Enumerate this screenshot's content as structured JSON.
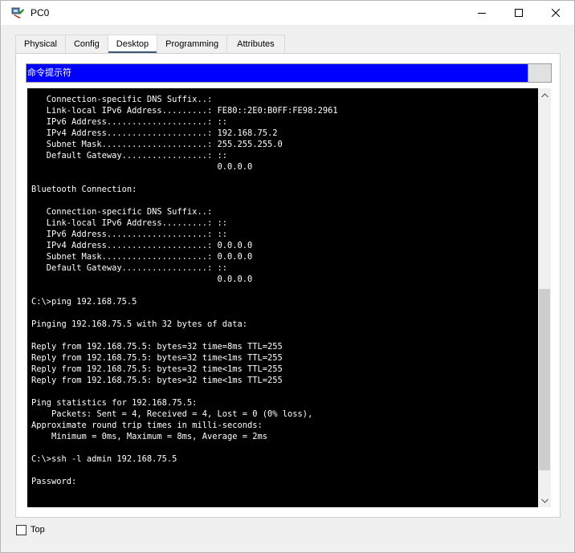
{
  "window": {
    "title": "PC0",
    "icon": "pc-device-icon"
  },
  "tabs": [
    {
      "label": "Physical",
      "active": false
    },
    {
      "label": "Config",
      "active": false
    },
    {
      "label": "Desktop",
      "active": true
    },
    {
      "label": "Programming",
      "active": false
    },
    {
      "label": "Attributes",
      "active": false
    }
  ],
  "cmd": {
    "title": "命令提示符",
    "lines": [
      "   Connection-specific DNS Suffix..:",
      "   Link-local IPv6 Address.........: FE80::2E0:B0FF:FE98:2961",
      "   IPv6 Address....................: ::",
      "   IPv4 Address....................: 192.168.75.2",
      "   Subnet Mask.....................: 255.255.255.0",
      "   Default Gateway.................: ::",
      "                                     0.0.0.0",
      "",
      "Bluetooth Connection:",
      "",
      "   Connection-specific DNS Suffix..:",
      "   Link-local IPv6 Address.........: ::",
      "   IPv6 Address....................: ::",
      "   IPv4 Address....................: 0.0.0.0",
      "   Subnet Mask.....................: 0.0.0.0",
      "   Default Gateway.................: ::",
      "                                     0.0.0.0",
      "",
      "C:\\>ping 192.168.75.5",
      "",
      "Pinging 192.168.75.5 with 32 bytes of data:",
      "",
      "Reply from 192.168.75.5: bytes=32 time=8ms TTL=255",
      "Reply from 192.168.75.5: bytes=32 time<1ms TTL=255",
      "Reply from 192.168.75.5: bytes=32 time<1ms TTL=255",
      "Reply from 192.168.75.5: bytes=32 time<1ms TTL=255",
      "",
      "Ping statistics for 192.168.75.5:",
      "    Packets: Sent = 4, Received = 4, Lost = 0 (0% loss),",
      "Approximate round trip times in milli-seconds:",
      "    Minimum = 0ms, Maximum = 8ms, Average = 2ms",
      "",
      "C:\\>ssh -l admin 192.168.75.5",
      "",
      "Password:"
    ]
  },
  "bottom": {
    "top_label": "Top",
    "top_checked": false
  },
  "colors": {
    "cmd_title_bg": "#0000ff",
    "terminal_bg": "#000000",
    "terminal_fg": "#ffffff",
    "active_tab_underline": "#3c5a78"
  }
}
